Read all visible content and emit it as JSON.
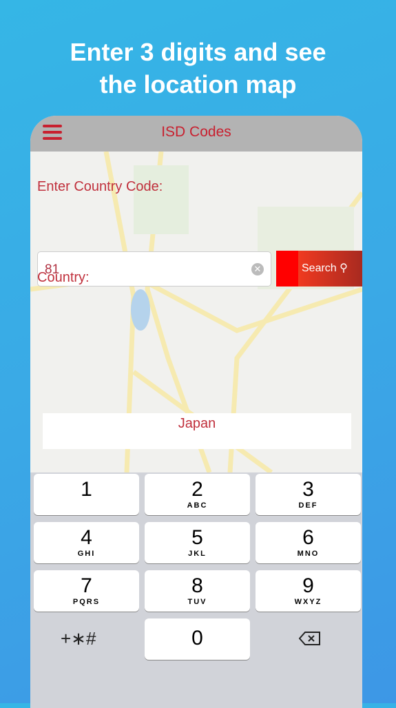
{
  "headline": [
    "Enter 3 digits and see",
    "the location map"
  ],
  "navbar": {
    "title": "ISD Codes",
    "menu_icon": "hamburger-icon"
  },
  "form": {
    "code_label": "Enter Country Code:",
    "code_value": "81",
    "search_label": "Search",
    "country_label": "Country:",
    "country_value": "Japan"
  },
  "keypad": {
    "keys": [
      {
        "n": "1",
        "l": ""
      },
      {
        "n": "2",
        "l": "ABC"
      },
      {
        "n": "3",
        "l": "DEF"
      },
      {
        "n": "4",
        "l": "GHI"
      },
      {
        "n": "5",
        "l": "JKL"
      },
      {
        "n": "6",
        "l": "MNO"
      },
      {
        "n": "7",
        "l": "PQRS"
      },
      {
        "n": "8",
        "l": "TUV"
      },
      {
        "n": "9",
        "l": "WXYZ"
      },
      {
        "n": "0",
        "l": ""
      }
    ],
    "symbols": "+∗#",
    "delete_icon": "backspace-icon"
  },
  "colors": {
    "accent": "#c8202f",
    "navbar": "#b3b3b3",
    "button": "#ff0000"
  }
}
